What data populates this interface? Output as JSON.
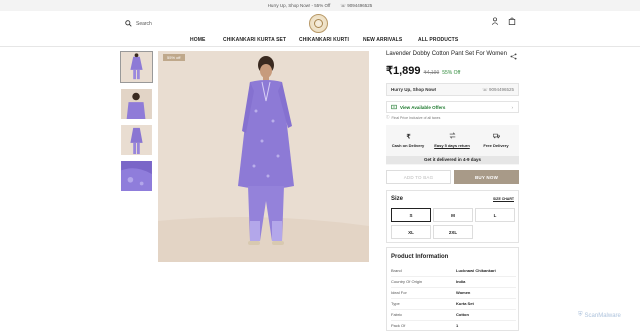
{
  "announcement": {
    "text": "Hurry Up, Shop Now! - 55% Off",
    "phone": "9094496525"
  },
  "header": {
    "search_label": "Search",
    "nav": [
      "HOME",
      "CHIKANKARI KURTA SET",
      "CHIKANKARI KURTI",
      "NEW ARRIVALS",
      "ALL PRODUCTS"
    ]
  },
  "gallery": {
    "badge": "55% off",
    "thumb_count": 4
  },
  "product": {
    "title": "Lavender Dobby Cotton Pant Set For Women",
    "price": "₹1,899",
    "mrp": "₹4,199",
    "discount": "55% Off",
    "hurry_text": "Hurry Up, Shop Now!",
    "hurry_phone": "9094496525",
    "offers_label": "View Available Offers",
    "tax_note": "Final Price Inclusive of all taxes",
    "features": [
      "Cash on Delivery",
      "Easy 5 days return",
      "Free Delivery"
    ],
    "delivery_note": "Get it delivered in 4-9 days",
    "add_to_bag": "ADD TO BAG",
    "buy_now": "BUY NOW",
    "size_heading": "Size",
    "size_chart": "SIZE CHART",
    "sizes": [
      "S",
      "M",
      "L",
      "XL",
      "2XL"
    ],
    "selected_size": "S",
    "info_heading": "Product Information",
    "info": [
      {
        "key": "Brand",
        "value": "Lucknawi Chikankari"
      },
      {
        "key": "Country Of Origin",
        "value": "India"
      },
      {
        "key": "Ideal For",
        "value": "Women"
      },
      {
        "key": "Type",
        "value": "Kurta Set"
      },
      {
        "key": "Fabric",
        "value": "Cotton"
      },
      {
        "key": "Pack Of",
        "value": "1"
      }
    ]
  },
  "watermark": "ScanMalware",
  "colors": {
    "accent_green": "#1d7a2e",
    "buy_button": "#a89a88",
    "kurta_purple": "#8d7ad6"
  }
}
